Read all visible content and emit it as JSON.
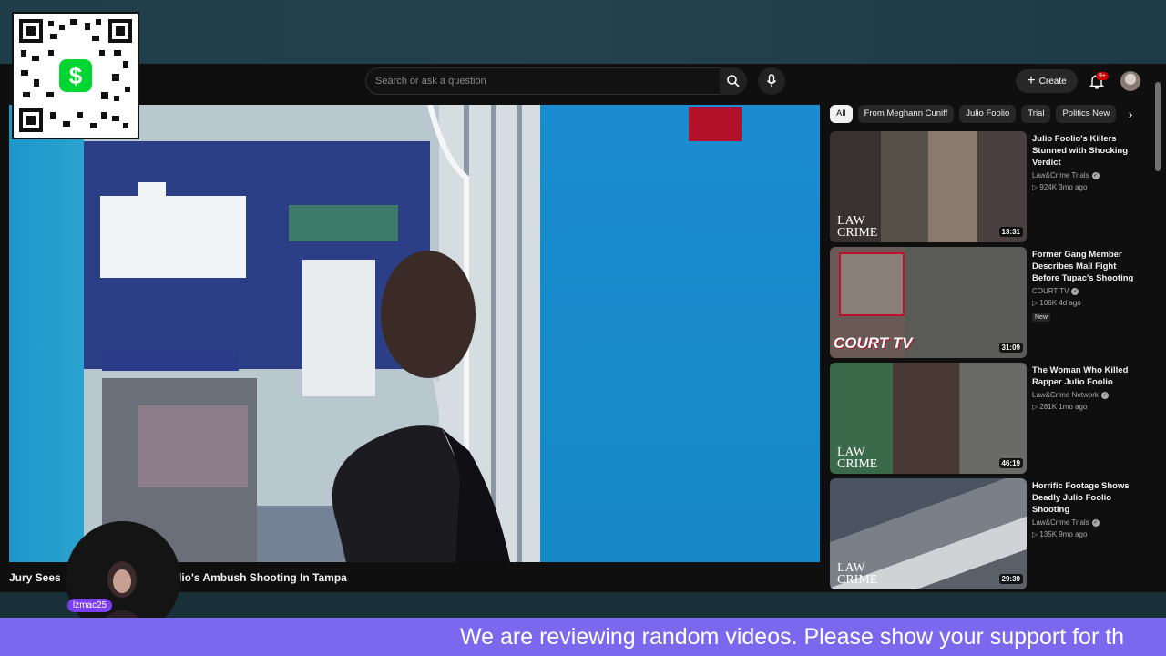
{
  "search": {
    "placeholder": "Search or ask a question"
  },
  "header": {
    "create_label": "Create",
    "notification_count": "9+"
  },
  "video": {
    "title_start": "Jury Sees",
    "title_end": "lio's Ambush Shooting In Tampa"
  },
  "chips": [
    "All",
    "From Meghann Cuniff",
    "Julio Foolio",
    "Trial",
    "Politics New"
  ],
  "related": [
    {
      "title": "Julio Foolio's Killers Stunned with Shocking Verdict",
      "channel": "Law&Crime Trials",
      "meta": "924K  3mo ago",
      "duration": "13:31",
      "logo": [
        "LAW",
        "CRIME"
      ]
    },
    {
      "title": "Former Gang Member Describes Mall Fight Before Tupac's Shooting",
      "channel": "COURT TV",
      "meta": "106K  4d ago",
      "badge": "New",
      "duration": "31:09",
      "logo_text": "COURT TV"
    },
    {
      "title": "The Woman Who Killed Rapper Julio Foolio",
      "channel": "Law&Crime Network",
      "meta": "281K  1mo ago",
      "duration": "46:19",
      "logo": [
        "LAW",
        "CRIME"
      ]
    },
    {
      "title": "Horrific Footage Shows Deadly Julio Foolio Shooting",
      "channel": "Law&Crime Trials",
      "meta": "135K  9mo ago",
      "duration": "29:39",
      "logo": [
        "LAW",
        "CRIME"
      ]
    }
  ],
  "streamer": {
    "name": "lzmac25"
  },
  "ticker": {
    "text": "We are reviewing random videos. Please show your support for th"
  },
  "colors": {
    "ticker": "#7b68ee",
    "cashapp": "#00d632",
    "accent_red": "#cc0000"
  }
}
